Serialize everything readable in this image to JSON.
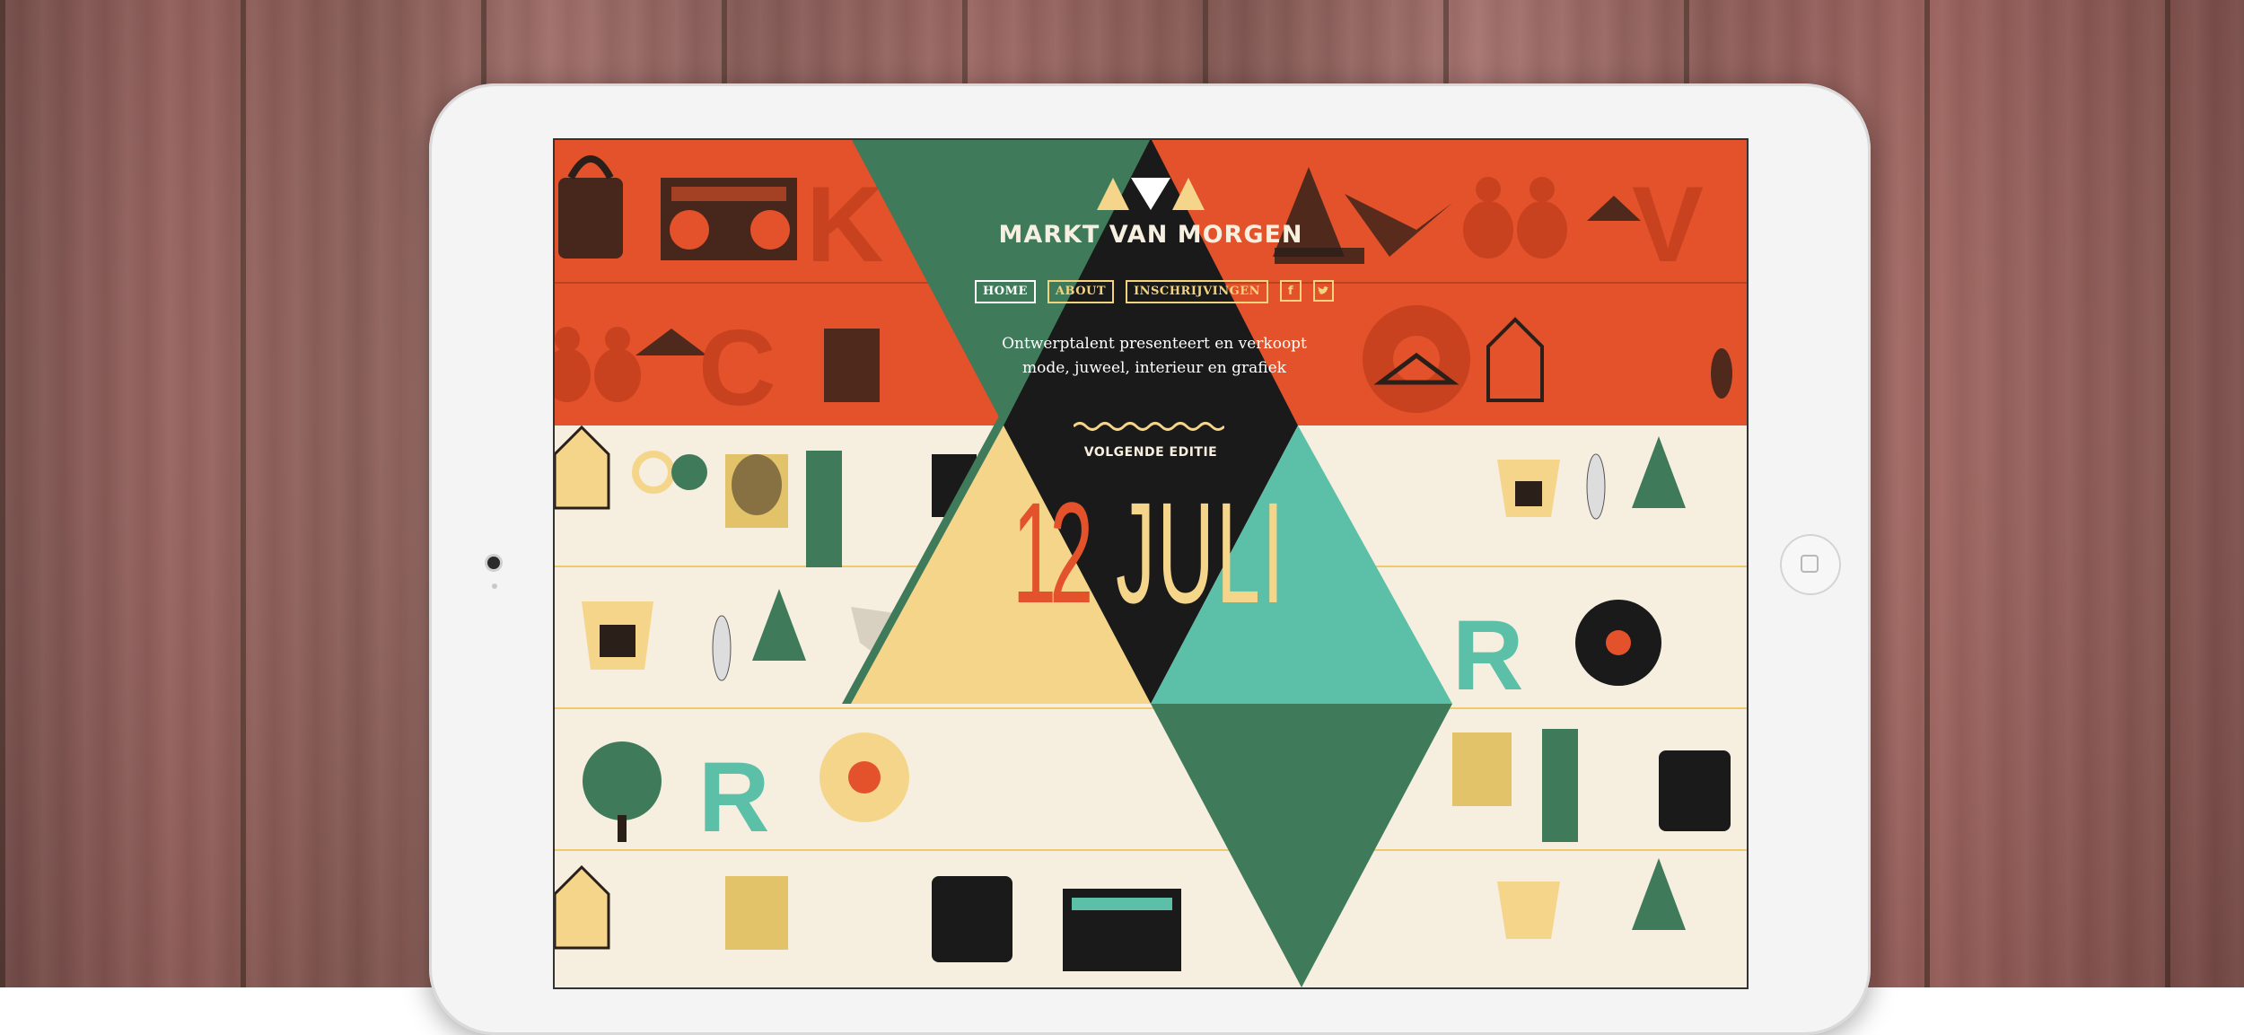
{
  "site": {
    "name": "MARKT VAN MORGEN",
    "tagline_line1": "Ontwerptalent presenteert en verkoopt",
    "tagline_line2": "mode, juweel, interieur en grafiek"
  },
  "nav": {
    "items": [
      {
        "label": "HOME",
        "active": true
      },
      {
        "label": "ABOUT",
        "active": false
      },
      {
        "label": "INSCHRIJVINGEN",
        "active": false
      }
    ],
    "facebook_icon": "f",
    "twitter_icon": "twitter-bird"
  },
  "edition": {
    "label": "VOLGENDE EDITIE",
    "day": "12",
    "month": "JULI"
  },
  "colors": {
    "orange": "#e3522a",
    "green": "#3f7a5a",
    "teal": "#5cc0a8",
    "yellow": "#f4d58a",
    "black": "#1a1a1a",
    "cream": "#f6efe0"
  }
}
